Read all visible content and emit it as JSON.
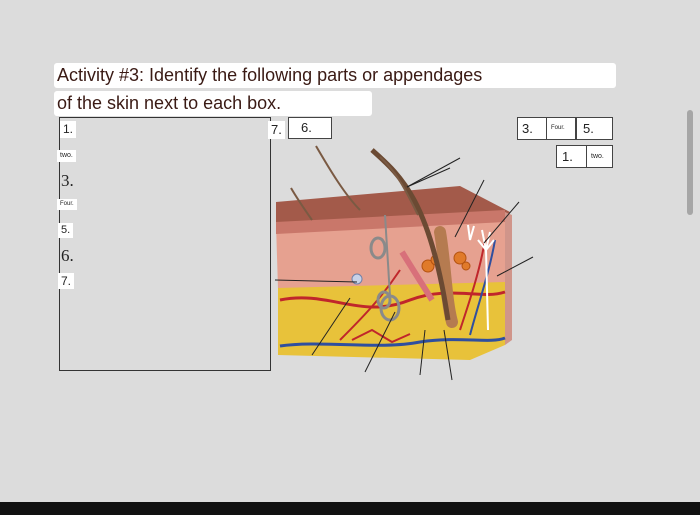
{
  "activity": {
    "title_line1": "Activity #3: Identify the following parts or appendages",
    "title_line2": "of the skin next to each box."
  },
  "left_labels": {
    "l1": "1.",
    "l2": "two.",
    "l3": "3.",
    "l4": "Four.",
    "l5": "5.",
    "l6": "6.",
    "l7": "7."
  },
  "top_labels": {
    "t7": "7.",
    "t6": "6.",
    "r3": "3.",
    "r_four": "Four.",
    "r5": "5.",
    "r1": "1.",
    "r_two": "two."
  },
  "colors": {
    "background": "#dcdcdc",
    "title_text": "#3a1a14",
    "skin_surface": "#a35a4a",
    "fat_layer": "#e8c23a",
    "blood_red": "#c0262b",
    "blood_blue": "#2f4f9f"
  }
}
